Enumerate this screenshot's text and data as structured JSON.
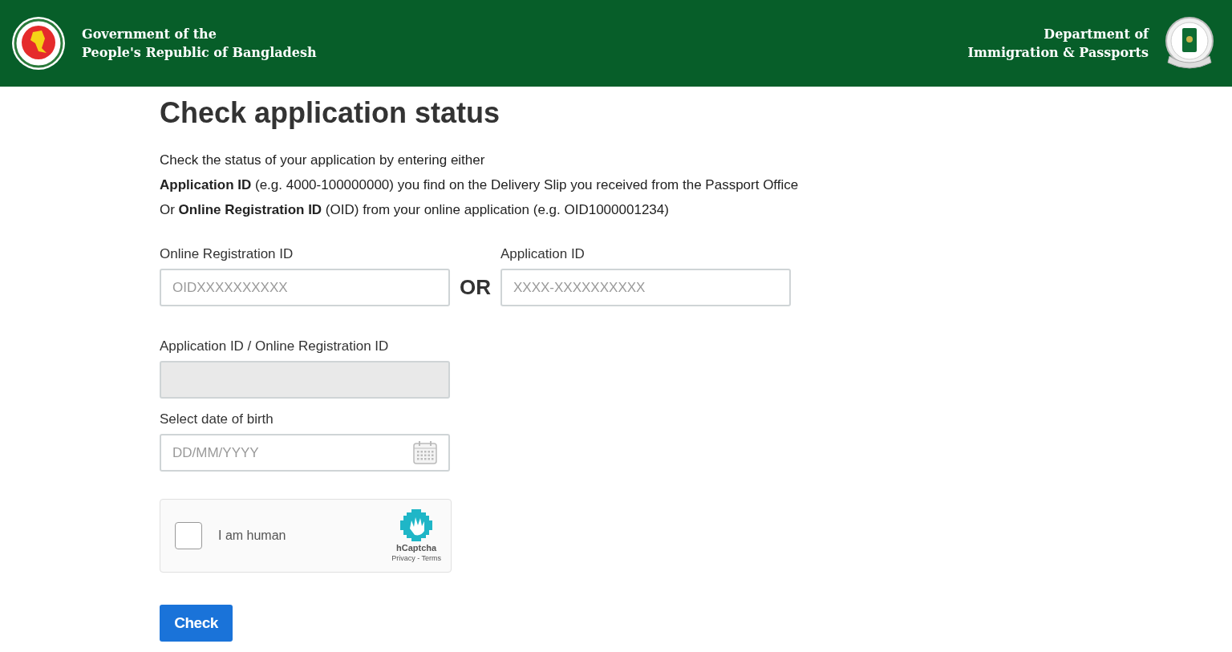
{
  "header": {
    "left_lines": [
      "Government of the",
      "People's Republic of Bangladesh"
    ],
    "right_lines": [
      "Department of",
      "Immigration & Passports"
    ]
  },
  "title": "Check application status",
  "intro": [
    "Check the status of your application by entering either",
    "**Application ID** (e.g. 4000-100000000) you find on the Delivery Slip you received from the Passport Office",
    "Or **Online Registration ID** (OID) from your online application (e.g. OID1000001234)"
  ],
  "id_fields": {
    "left": {
      "label": "Online Registration ID",
      "placeholder": "OIDXXXXXXXXXX"
    },
    "separator": "OR",
    "right": {
      "label": "Application ID",
      "placeholder": "XXXX-XXXXXXXXXX"
    }
  },
  "combined_field": {
    "label": "Application ID / Online Registration ID",
    "disabled": true
  },
  "dob_field": {
    "label": "Select date of birth",
    "placeholder": "DD/MM/YYYY"
  },
  "captcha": {
    "label": "I am human",
    "checked": false,
    "brand": "hCaptcha",
    "links": [
      "Privacy",
      "-",
      "Terms"
    ]
  },
  "submit": "Check"
}
